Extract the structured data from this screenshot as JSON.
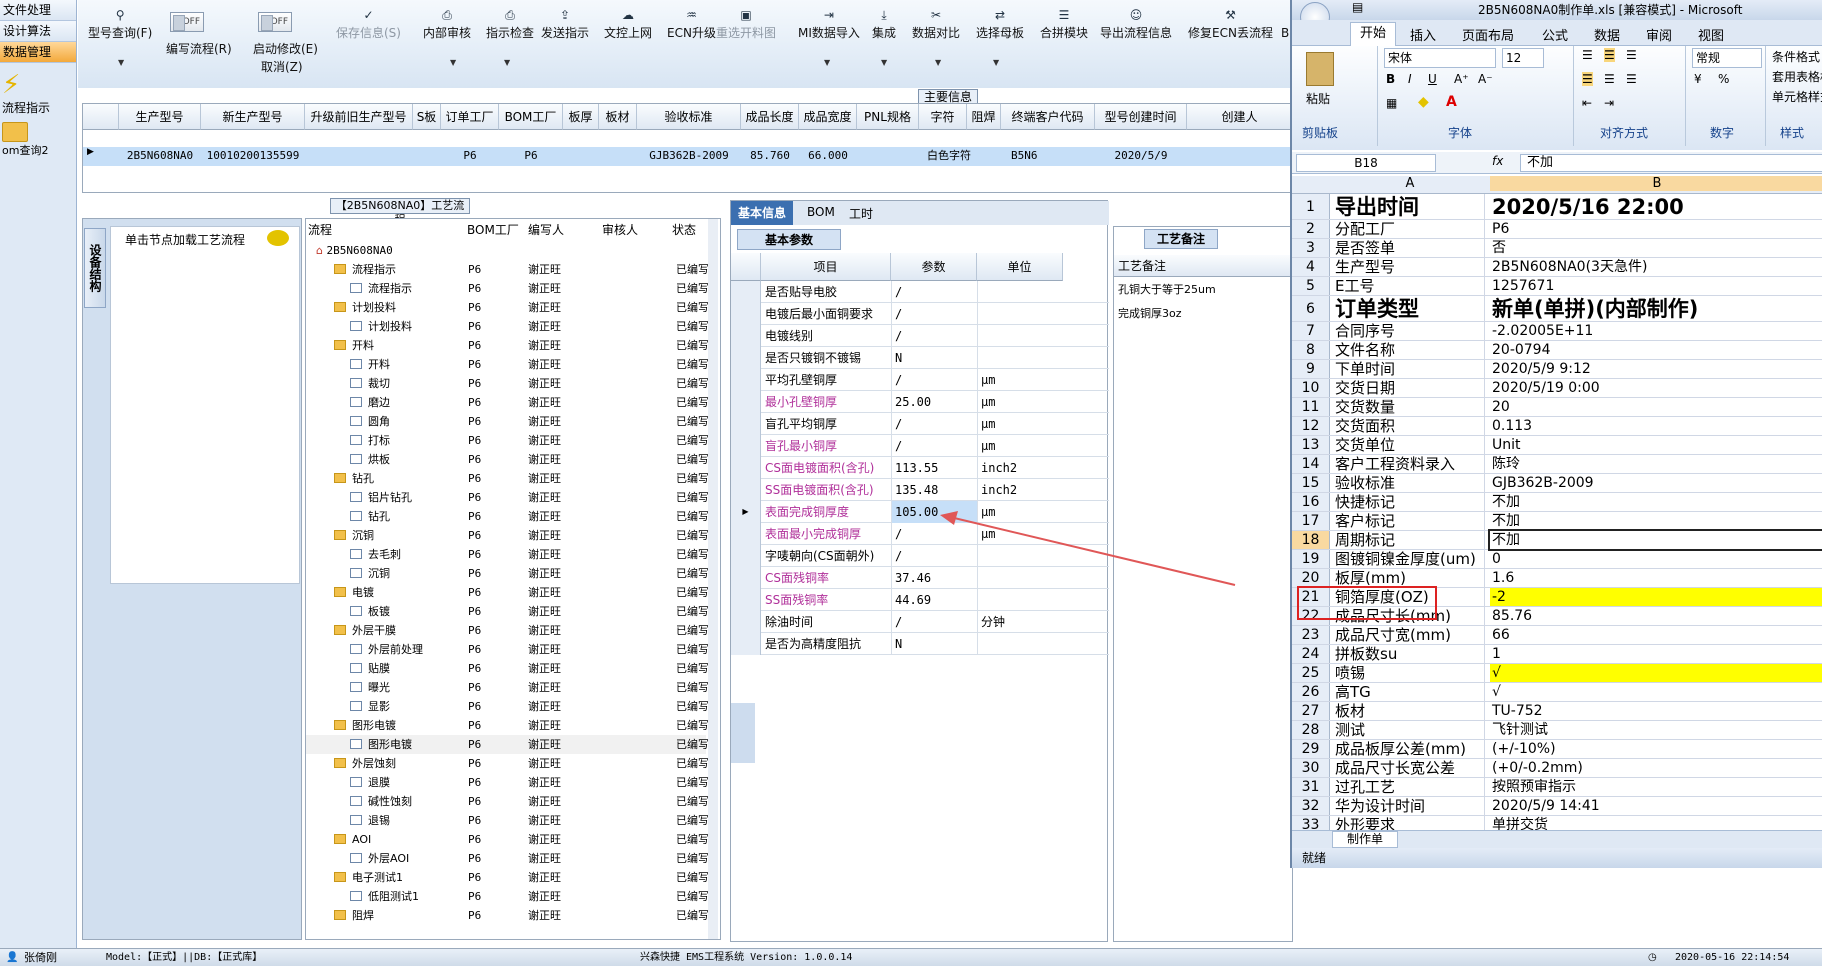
{
  "left_nav": {
    "items": [
      "文件处理",
      "设计算法",
      "数据管理"
    ],
    "flow_label": "流程指示",
    "bom_label": "om查询2"
  },
  "toolbar": {
    "query": "型号查询(F)",
    "edit_flow": "编写流程(R)",
    "off": "OFF",
    "start_edit": "启动修改(E)",
    "cancel": "取消(Z)",
    "save": "保存信息(S)",
    "review": "内部审核",
    "check": "指示检查",
    "send": "发送指示",
    "upload": "文控上网",
    "ecn": "ECN升级",
    "redraw": "重选开料图",
    "mi_import": "MI数据导入",
    "integrate": "集成",
    "compare": "数据对比",
    "select": "选择母板",
    "merge": "合拼模块",
    "export": "导出流程信息",
    "repair": "修复ECN丢流程",
    "more": "B"
  },
  "main_info_label": "主要信息",
  "upper_grid": {
    "headers": [
      "生产型号",
      "新生产型号",
      "升级前旧生产型号",
      "S板",
      "订单工厂",
      "BOM工厂",
      "板厚",
      "板材",
      "验收标准",
      "成品长度",
      "成品宽度",
      "PNL规格",
      "字符",
      "阻焊",
      "终端客户代码",
      "型号创建时间",
      "创建人"
    ],
    "row": [
      "2B5N608NA0",
      "10010200135599",
      "",
      "",
      "P6",
      "P6",
      "",
      "",
      "GJB362B-2009",
      "85.760",
      "66.000",
      "",
      "白色字符",
      "",
      "B5N6",
      "2020/5/9",
      ""
    ]
  },
  "process_title": "【2B5N608NA0】工艺流程",
  "struct_tab": "设备结构",
  "flow_hint": "单击节点加载工艺流程",
  "tree": {
    "headers": [
      "流程",
      "BOM工厂",
      "编写人",
      "审核人",
      "状态"
    ],
    "root": "2B5N608NA0",
    "rows": [
      {
        "l": 1,
        "n": "流程指示"
      },
      {
        "l": 2,
        "n": "流程指示"
      },
      {
        "l": 1,
        "n": "计划投料"
      },
      {
        "l": 2,
        "n": "计划投料"
      },
      {
        "l": 1,
        "n": "开料"
      },
      {
        "l": 2,
        "n": "开料"
      },
      {
        "l": 2,
        "n": "裁切"
      },
      {
        "l": 2,
        "n": "磨边"
      },
      {
        "l": 2,
        "n": "圆角"
      },
      {
        "l": 2,
        "n": "打标"
      },
      {
        "l": 2,
        "n": "烘板"
      },
      {
        "l": 1,
        "n": "钻孔"
      },
      {
        "l": 2,
        "n": "铝片钻孔"
      },
      {
        "l": 2,
        "n": "钻孔"
      },
      {
        "l": 1,
        "n": "沉铜"
      },
      {
        "l": 2,
        "n": "去毛刺"
      },
      {
        "l": 2,
        "n": "沉铜"
      },
      {
        "l": 1,
        "n": "电镀"
      },
      {
        "l": 2,
        "n": "板镀"
      },
      {
        "l": 1,
        "n": "外层干膜"
      },
      {
        "l": 2,
        "n": "外层前处理"
      },
      {
        "l": 2,
        "n": "贴膜"
      },
      {
        "l": 2,
        "n": "曝光"
      },
      {
        "l": 2,
        "n": "显影"
      },
      {
        "l": 1,
        "n": "图形电镀"
      },
      {
        "l": 2,
        "n": "图形电镀"
      },
      {
        "l": 1,
        "n": "外层蚀刻"
      },
      {
        "l": 2,
        "n": "退膜"
      },
      {
        "l": 2,
        "n": "碱性蚀刻"
      },
      {
        "l": 2,
        "n": "退锡"
      },
      {
        "l": 1,
        "n": "AOI"
      },
      {
        "l": 2,
        "n": "外层AOI"
      },
      {
        "l": 1,
        "n": "电子测试1"
      },
      {
        "l": 2,
        "n": "低阻测试1"
      },
      {
        "l": 1,
        "n": "阻焊"
      }
    ],
    "factory": "P6",
    "author": "谢正旺",
    "status": "已编写"
  },
  "tabs": [
    "基本信息",
    "BOM",
    "工时"
  ],
  "basic_params_label": "基本参数",
  "params": {
    "headers": [
      "项目",
      "参数",
      "单位"
    ],
    "rows": [
      {
        "k": "是否贴导电胶",
        "v": "/",
        "u": "",
        "p": false
      },
      {
        "k": "电镀后最小面铜要求",
        "v": "/",
        "u": "",
        "p": false
      },
      {
        "k": "电镀线别",
        "v": "/",
        "u": "",
        "p": false
      },
      {
        "k": "是否只镀铜不镀锡",
        "v": "N",
        "u": "",
        "p": false
      },
      {
        "k": "平均孔壁铜厚",
        "v": "/",
        "u": "μm",
        "p": false
      },
      {
        "k": "最小孔壁铜厚",
        "v": "25.00",
        "u": "μm",
        "p": true
      },
      {
        "k": "盲孔平均铜厚",
        "v": "/",
        "u": "μm",
        "p": false
      },
      {
        "k": "盲孔最小铜厚",
        "v": "/",
        "u": "μm",
        "p": true
      },
      {
        "k": "CS面电镀面积(含孔)",
        "v": "113.55",
        "u": "inch2",
        "p": true
      },
      {
        "k": "SS面电镀面积(含孔)",
        "v": "135.48",
        "u": "inch2",
        "p": true
      },
      {
        "k": "表面完成铜厚度",
        "v": "105.00",
        "u": "μm",
        "p": true
      },
      {
        "k": "表面最小完成铜厚",
        "v": "/",
        "u": "μm",
        "p": true
      },
      {
        "k": "字唛朝向(CS面朝外)",
        "v": "/",
        "u": "",
        "p": false
      },
      {
        "k": "CS面残铜率",
        "v": "37.46",
        "u": "",
        "p": true
      },
      {
        "k": "SS面残铜率",
        "v": "44.69",
        "u": "",
        "p": true
      },
      {
        "k": "除油时间",
        "v": "/",
        "u": "分钟",
        "p": false
      },
      {
        "k": "是否为高精度阻抗",
        "v": "N",
        "u": "",
        "p": false
      }
    ]
  },
  "remarks": {
    "tab": "工艺备注",
    "header": "工艺备注",
    "lines": [
      "孔铜大于等于25um",
      "完成铜厚3oz"
    ]
  },
  "excel": {
    "title": "2B5N608NA0制作单.xls [兼容模式] - Microsoft",
    "tabs": [
      "开始",
      "插入",
      "页面布局",
      "公式",
      "数据",
      "审阅",
      "视图"
    ],
    "font": "宋体",
    "size": "12",
    "format": "常规",
    "groups": [
      "剪贴板",
      "字体",
      "对齐方式",
      "数字",
      "样式"
    ],
    "paste": "粘贴",
    "style_btns": [
      "条件格式",
      "套用表格格式",
      "单元格样式"
    ],
    "cellref": "B18",
    "formula": "不加",
    "colA": "A",
    "colB": "B",
    "rows": [
      [
        "1",
        "导出时间",
        "2020/5/16 22:00"
      ],
      [
        "2",
        "分配工厂",
        "P6"
      ],
      [
        "3",
        "是否签单",
        "否"
      ],
      [
        "4",
        "生产型号",
        "2B5N608NA0(3天急件)"
      ],
      [
        "5",
        "E工号",
        "1257671"
      ],
      [
        "6",
        "订单类型",
        "新单(单拼)(内部制作)"
      ],
      [
        "7",
        "合同序号",
        "-2.02005E+11"
      ],
      [
        "8",
        "文件名称",
        "20-0794"
      ],
      [
        "9",
        "下单时间",
        "2020/5/9 9:12"
      ],
      [
        "10",
        "交货日期",
        "2020/5/19 0:00"
      ],
      [
        "11",
        "交货数量",
        "20"
      ],
      [
        "12",
        "交货面积",
        "0.113"
      ],
      [
        "13",
        "交货单位",
        "Unit"
      ],
      [
        "14",
        "客户工程资料录入",
        "陈玲"
      ],
      [
        "15",
        "验收标准",
        "GJB362B-2009"
      ],
      [
        "16",
        "快捷标记",
        "不加"
      ],
      [
        "17",
        "客户标记",
        "不加"
      ],
      [
        "18",
        "周期标记",
        "不加"
      ],
      [
        "19",
        "图镀铜镍金厚度(um)",
        "0"
      ],
      [
        "20",
        "板厚(mm)",
        "1.6"
      ],
      [
        "21",
        "铜箔厚度(OZ)",
        "-2"
      ],
      [
        "22",
        "成品尺寸长(mm)",
        "85.76"
      ],
      [
        "23",
        "成品尺寸宽(mm)",
        "66"
      ],
      [
        "24",
        "拼板数su",
        "1"
      ],
      [
        "25",
        "喷锡",
        "√"
      ],
      [
        "26",
        "高TG",
        "√"
      ],
      [
        "27",
        "板材",
        "TU-752"
      ],
      [
        "28",
        "测试",
        "飞针测试"
      ],
      [
        "29",
        "成品板厚公差(mm)",
        "(+/-10%)"
      ],
      [
        "30",
        "成品尺寸长宽公差",
        "(+0/-0.2mm)"
      ],
      [
        "31",
        "过孔工艺",
        "按照预审指示"
      ],
      [
        "32",
        "华为设计时间",
        "2020/5/9 14:41"
      ],
      [
        "33",
        "外形要求",
        "单拼交货"
      ]
    ],
    "sheet_tab": "制作单",
    "status": "就绪"
  },
  "status": {
    "user": "张倚刚",
    "model": "Model:【正式】||DB:【正式库】",
    "system": "兴森快捷 EMS工程系统 Version: 1.0.0.14",
    "time": "2020-05-16 22:14:54"
  }
}
